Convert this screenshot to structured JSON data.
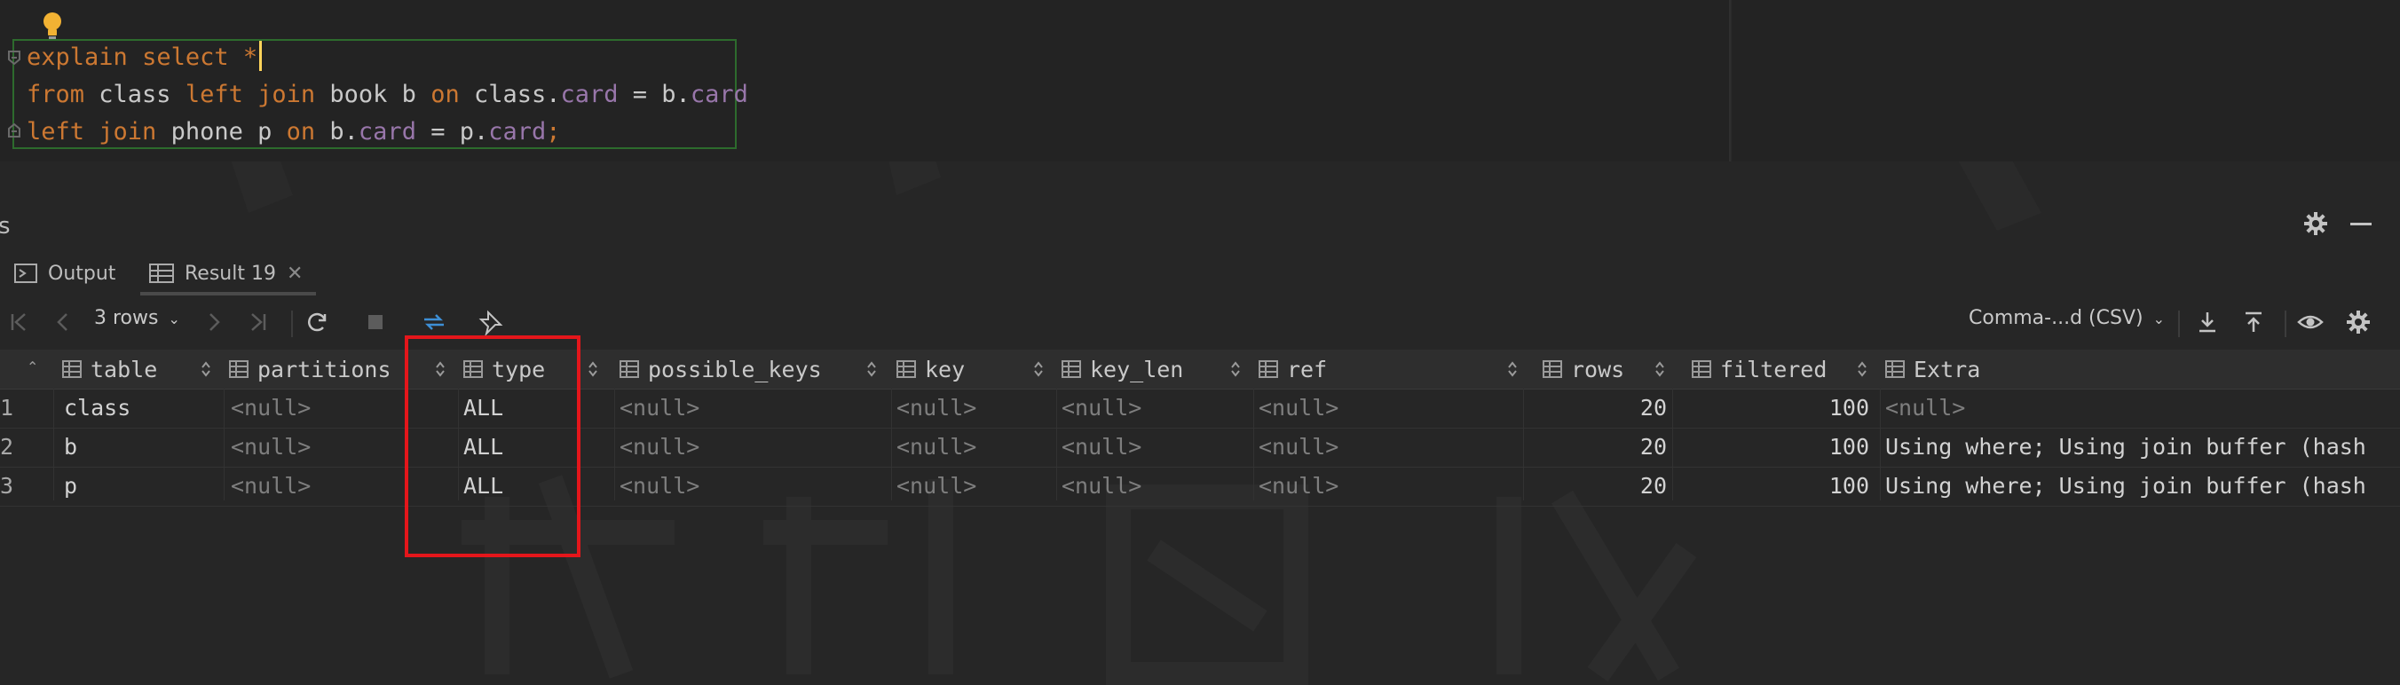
{
  "editor": {
    "lines": [
      [
        {
          "t": "explain",
          "c": "kw"
        },
        {
          "t": " ",
          "c": "op"
        },
        {
          "t": "select",
          "c": "kw"
        },
        {
          "t": " ",
          "c": "op"
        },
        {
          "t": "*",
          "c": "kw"
        }
      ],
      [
        {
          "t": "from",
          "c": "kw"
        },
        {
          "t": " class ",
          "c": "id"
        },
        {
          "t": "left join",
          "c": "kw"
        },
        {
          "t": " book b ",
          "c": "id"
        },
        {
          "t": "on",
          "c": "kw"
        },
        {
          "t": " class.",
          "c": "id"
        },
        {
          "t": "card",
          "c": "fld"
        },
        {
          "t": " = b.",
          "c": "id"
        },
        {
          "t": "card",
          "c": "fld"
        }
      ],
      [
        {
          "t": "left join",
          "c": "kw"
        },
        {
          "t": " phone p ",
          "c": "id"
        },
        {
          "t": "on",
          "c": "kw"
        },
        {
          "t": " b.",
          "c": "id"
        },
        {
          "t": "card",
          "c": "fld"
        },
        {
          "t": " = p.",
          "c": "id"
        },
        {
          "t": "card",
          "c": "fld"
        },
        {
          "t": ";",
          "c": "kw"
        }
      ]
    ]
  },
  "panel": {
    "title_fragment": "s"
  },
  "tabs": [
    {
      "label": "Output",
      "icon": "output-icon"
    },
    {
      "label": "Result 19",
      "icon": "table-icon",
      "closable": true
    }
  ],
  "toolbar": {
    "rows_label": "3 rows",
    "export_format": "Comma-...d (CSV)"
  },
  "grid": {
    "columns": [
      "table",
      "partitions",
      "type",
      "possible_keys",
      "key",
      "key_len",
      "ref",
      "rows",
      "filtered",
      "Extra"
    ],
    "rows": [
      [
        "1",
        "class",
        "<null>",
        "ALL",
        "<null>",
        "<null>",
        "<null>",
        "<null>",
        "20",
        "100",
        "<null>"
      ],
      [
        "2",
        "b",
        "<null>",
        "ALL",
        "<null>",
        "<null>",
        "<null>",
        "<null>",
        "20",
        "100",
        "Using where; Using join buffer (hash"
      ],
      [
        "3",
        "p",
        "<null>",
        "ALL",
        "<null>",
        "<null>",
        "<null>",
        "<null>",
        "20",
        "100",
        "Using where; Using join buffer (hash"
      ]
    ]
  },
  "colors": {
    "keyword": "#cc7832",
    "field": "#9876aa",
    "highlight": "#e4161b",
    "statement_border": "#2d6b2d"
  }
}
